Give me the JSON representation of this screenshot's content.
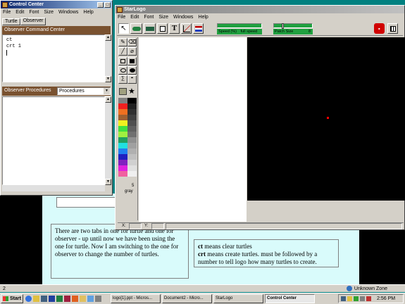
{
  "control_center": {
    "title": "Control Center",
    "menu": [
      "File",
      "Edit",
      "Font",
      "Size",
      "Windows",
      "Help"
    ],
    "tabs": [
      "Turtle",
      "Observer"
    ],
    "command_center_label": "Observer Command Center",
    "commands": [
      "ct",
      "crt 1"
    ],
    "procedures_label": "Observer Procedures",
    "procedures_select": "Procedures"
  },
  "starlogo": {
    "title": "StarLogo",
    "menu": [
      "File",
      "Edit",
      "Font",
      "Size",
      "Windows",
      "Help"
    ],
    "speed_label": "Speed (%)",
    "speed_value": "full speed",
    "patch_label": "Patch Size",
    "patch_value": "8",
    "color_name": "gray",
    "color_number": "5",
    "x_label": "X:",
    "y_label": "Y:",
    "speed_fill": 1.0,
    "patch_fill": 0.2
  },
  "notes": {
    "left": "There are two tabs in one for turtle and one for observer - up until now we have been using the one for turtle. Now I am switching to the one for observer to change the number of turtles.",
    "right_term1": "ct",
    "right_text1": " means clear turtles",
    "right_term2": "crt",
    "right_text2": " means create turtles. must be followed by a number to tell logo how many turtles to create."
  },
  "status": {
    "zone": "Unknown Zone",
    "page_num": "2"
  },
  "taskbar": {
    "start": "Start",
    "items": [
      "logo[1].ppt - Micros...",
      "Document2 - Micro...",
      "StarLogo",
      "Control Center"
    ],
    "clock": "2:56 PM"
  },
  "colors": {
    "graphics_bg": "#000000",
    "turtle": "#ff0000",
    "slide_bg": "#d9fbfb"
  }
}
